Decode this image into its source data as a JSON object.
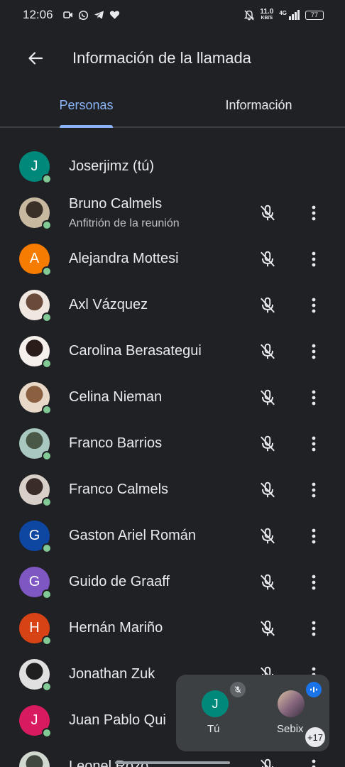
{
  "status_bar": {
    "time": "12:06",
    "net_speed": "11.0",
    "net_unit": "KB/S",
    "signal_label": "4G",
    "battery": "77"
  },
  "header": {
    "title": "Información de la llamada",
    "back_icon": "arrow-back-icon"
  },
  "tabs": [
    {
      "label": "Personas",
      "active": true
    },
    {
      "label": "Información",
      "active": false
    }
  ],
  "participants": [
    {
      "name": "Joserjimz (tú)",
      "avatar_letter": "J",
      "avatar_color": "#00897b",
      "photo": false,
      "show_actions": false
    },
    {
      "name": "Bruno Calmels",
      "subtitle": "Anfitrión de la reunión",
      "photo": true,
      "photo_colors": [
        "#c8b8a0",
        "#3a3028"
      ],
      "show_actions": true
    },
    {
      "name": "Alejandra Mottesi",
      "avatar_letter": "A",
      "avatar_color": "#f57c00",
      "photo": false,
      "show_actions": true
    },
    {
      "name": "Axl Vázquez",
      "photo": true,
      "photo_colors": [
        "#f0e8e0",
        "#6a4a38"
      ],
      "show_actions": true
    },
    {
      "name": "Carolina Berasategui",
      "photo": true,
      "photo_colors": [
        "#f5f0ec",
        "#2a1c18"
      ],
      "show_actions": true
    },
    {
      "name": "Celina Nieman",
      "photo": true,
      "photo_colors": [
        "#e8d8c8",
        "#8a6040"
      ],
      "show_actions": true
    },
    {
      "name": "Franco Barrios",
      "photo": true,
      "photo_colors": [
        "#a8c8c0",
        "#4a5848"
      ],
      "show_actions": true
    },
    {
      "name": "Franco Calmels",
      "photo": true,
      "photo_colors": [
        "#d8d0c8",
        "#3a2c28"
      ],
      "show_actions": true
    },
    {
      "name": "Gaston Ariel Román",
      "avatar_letter": "G",
      "avatar_color": "#0d47a1",
      "photo": false,
      "show_actions": true
    },
    {
      "name": "Guido de Graaff",
      "avatar_letter": "G",
      "avatar_color": "#7e57c2",
      "photo": false,
      "show_actions": true
    },
    {
      "name": "Hernán Mariño",
      "avatar_letter": "H",
      "avatar_color": "#d84315",
      "photo": false,
      "show_actions": true
    },
    {
      "name": "Jonathan Zuk",
      "photo": true,
      "photo_colors": [
        "#e0e0e0",
        "#202020"
      ],
      "show_actions": true
    },
    {
      "name": "Juan Pablo Qui",
      "avatar_letter": "J",
      "avatar_color": "#d81b60",
      "photo": false,
      "show_actions": false
    },
    {
      "name": "Leonel Rozo",
      "photo": true,
      "photo_colors": [
        "#d0d8d0",
        "#404840"
      ],
      "show_actions": true
    }
  ],
  "pip": {
    "you_letter": "J",
    "you_label": "Tú",
    "other_label": "Sebix",
    "extra_count": "+17"
  },
  "colors": {
    "background": "#202124",
    "accent": "#8ab4f8",
    "presence": "#81c995"
  }
}
